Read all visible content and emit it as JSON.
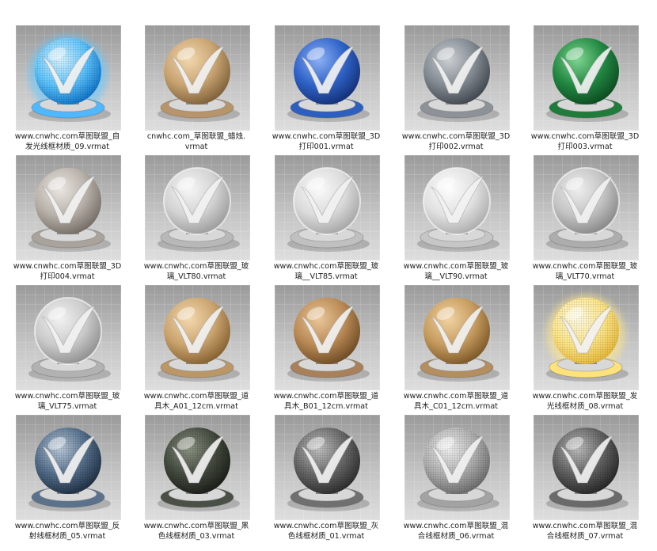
{
  "items": [
    {
      "line1": "www.cnwhc.com草图联盟_自",
      "line2": "发光线框材质_09.vrmat",
      "icon": "material-sphere-icon",
      "kind": "glow",
      "c1": "#d9f3ff",
      "c2": "#5fc6ff",
      "c3": "#0c74c9",
      "base": "#4fb8ff",
      "wire": true
    },
    {
      "line1": "cnwhc.com_草图联盟_蜡烛.",
      "line2": "vrmat",
      "icon": "material-sphere-icon",
      "kind": "solid",
      "c1": "#f1d7ad",
      "c2": "#c9a472",
      "c3": "#7d5f38",
      "base": "#b8946a",
      "wire": false
    },
    {
      "line1": "www.cnwhc.com草图联盟_3D",
      "line2": "打印001.vrmat",
      "icon": "material-sphere-icon",
      "kind": "solid",
      "c1": "#8cb0f4",
      "c2": "#2f63c8",
      "c3": "#132f76",
      "base": "#2d5fbf",
      "wire": false
    },
    {
      "line1": "www.cnwhc.com草图联盟_3D",
      "line2": "打印002.vrmat",
      "icon": "material-sphere-icon",
      "kind": "solid",
      "c1": "#cbcfd3",
      "c2": "#838a92",
      "c3": "#3f454c",
      "base": "#8c9298",
      "wire": false
    },
    {
      "line1": "www.cnwhc.com草图联盟_3D",
      "line2": "打印003.vrmat",
      "icon": "material-sphere-icon",
      "kind": "solid",
      "c1": "#7fd48f",
      "c2": "#218842",
      "c3": "#0d4a20",
      "base": "#1f7c3b",
      "wire": false
    },
    {
      "line1": "www.cnwhc.com草图联盟_3D",
      "line2": "打印004.vrmat",
      "icon": "material-sphere-icon",
      "kind": "solid",
      "c1": "#eae6e1",
      "c2": "#b8b1a9",
      "c3": "#736c65",
      "base": "#a9a39c",
      "wire": false
    },
    {
      "line1": "www.cnwhc.com草图联盟_玻",
      "line2": "璃_VLT80.vrmat",
      "icon": "material-sphere-icon",
      "kind": "glass",
      "c1": "#f6f6f6",
      "c2": "#d3d3d3",
      "c3": "#9a9a9a",
      "base": "#b8b8b8",
      "wire": false
    },
    {
      "line1": "www.cnwhc.com草图联盟_玻",
      "line2": "璃__VLT85.vrmat",
      "icon": "material-sphere-icon",
      "kind": "glass",
      "c1": "#fafafa",
      "c2": "#dbdbdb",
      "c3": "#a4a4a4",
      "base": "#c0c0c0",
      "wire": false
    },
    {
      "line1": "www.cnwhc.com草图联盟_玻",
      "line2": "璃__VLT90.vrmat",
      "icon": "material-sphere-icon",
      "kind": "glass",
      "c1": "#fdfdfd",
      "c2": "#e1e1e1",
      "c3": "#ababab",
      "base": "#c6c6c6",
      "wire": false
    },
    {
      "line1": "www.cnwhc.com草图联盟_玻",
      "line2": "璃_VLT70.vrmat",
      "icon": "material-sphere-icon",
      "kind": "glass",
      "c1": "#eeeeee",
      "c2": "#c4c4c4",
      "c3": "#868686",
      "base": "#adadad",
      "wire": false
    },
    {
      "line1": "www.cnwhc.com草图联盟_玻",
      "line2": "璃_VLT75.vrmat",
      "icon": "material-sphere-icon",
      "kind": "glass",
      "c1": "#f1f1f1",
      "c2": "#cbcbcb",
      "c3": "#8e8e8e",
      "base": "#b2b2b2",
      "wire": false
    },
    {
      "line1": "www.cnwhc.com草图联盟_道",
      "line2": "具木_A01_12cm.vrmat",
      "icon": "material-sphere-icon",
      "kind": "solid",
      "c1": "#f2d8ae",
      "c2": "#cba46f",
      "c3": "#85602f",
      "base": "#bb9667",
      "wire": false
    },
    {
      "line1": "www.cnwhc.com草图联盟_道",
      "line2": "具木_B01_12cm.vrmat",
      "icon": "material-sphere-icon",
      "kind": "solid",
      "c1": "#e9c69a",
      "c2": "#b98a55",
      "c3": "#6d4a24",
      "base": "#a8815a",
      "wire": false
    },
    {
      "line1": "www.cnwhc.com草图联盟_道",
      "line2": "具木_C01_12cm.vrmat",
      "icon": "material-sphere-icon",
      "kind": "solid",
      "c1": "#f0d3a2",
      "c2": "#c79c5f",
      "c3": "#7b5727",
      "base": "#b38e5f",
      "wire": false
    },
    {
      "line1": "www.cnwhc.com草图联盟_发",
      "line2": "光线框材质_08.vrmat",
      "icon": "material-sphere-icon",
      "kind": "glow",
      "c1": "#fffbe6",
      "c2": "#ffe88a",
      "c3": "#e8b93a",
      "base": "#ffe27a",
      "wire": true
    },
    {
      "line1": "www.cnwhc.com草图联盟_反",
      "line2": "射线框材质_05.vrmat",
      "icon": "material-sphere-icon",
      "kind": "solid",
      "c1": "#b9c9d9",
      "c2": "#55708d",
      "c3": "#1f2f43",
      "base": "#5a728c",
      "wire": true
    },
    {
      "line1": "www.cnwhc.com草图联盟_黑",
      "line2": "色线框材质_03.vrmat",
      "icon": "material-sphere-icon",
      "kind": "solid",
      "c1": "#8c9484",
      "c2": "#454c40",
      "c3": "#1b1e19",
      "base": "#4a5045",
      "wire": true
    },
    {
      "line1": "www.cnwhc.com草图联盟_灰",
      "line2": "色线框材质_01.vrmat",
      "icon": "material-sphere-icon",
      "kind": "solid",
      "c1": "#c2c2c2",
      "c2": "#6a6a6a",
      "c3": "#2c2c2c",
      "base": "#707070",
      "wire": true
    },
    {
      "line1": "www.cnwhc.com草图联盟_混",
      "line2": "合线框材质_06.vrmat",
      "icon": "material-sphere-icon",
      "kind": "solid",
      "c1": "#f1f1f1",
      "c2": "#b2b2b2",
      "c3": "#6c6c6c",
      "base": "#a3a3a3",
      "wire": true
    },
    {
      "line1": "www.cnwhc.com草图联盟_混",
      "line2": "合线框材质_07.vrmat",
      "icon": "material-sphere-icon",
      "kind": "solid",
      "c1": "#bdbdbd",
      "c2": "#636363",
      "c3": "#262626",
      "base": "#6a6a6a",
      "wire": true
    }
  ]
}
